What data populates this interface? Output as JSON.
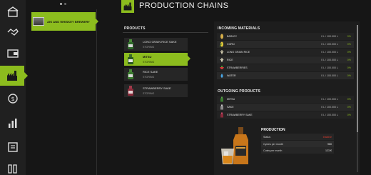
{
  "sidebar": {
    "items": [
      {
        "icon": "warehouse-icon"
      },
      {
        "icon": "handshake-icon"
      },
      {
        "icon": "wallet-icon"
      },
      {
        "icon": "calendar-icon"
      },
      {
        "icon": "production-chains-icon"
      },
      {
        "icon": "contracts-icon"
      },
      {
        "icon": "statistics-icon"
      },
      {
        "icon": "list-icon"
      },
      {
        "icon": "finances-icon"
      }
    ]
  },
  "production_point": {
    "label": "AKI AND WHISKEY BREWERY"
  },
  "header": {
    "title": "PRODUCTION CHAINS"
  },
  "products": {
    "title": "PRODUCTS",
    "items": [
      {
        "name": "LONG GRAIN RICE SAKE",
        "status": "STORING"
      },
      {
        "name": "MITSU",
        "status": "STORING"
      },
      {
        "name": "RICE SAKE",
        "status": "STORING"
      },
      {
        "name": "STRAWBERRY SAKE",
        "status": "STORING"
      }
    ]
  },
  "incoming": {
    "title": "INCOMING MATERIALS",
    "items": [
      {
        "name": "BARLEY",
        "qty": "0 L / 100.000 L",
        "pct": "0%",
        "icon": "barley-icon",
        "color": "#d8b04a"
      },
      {
        "name": "CORN",
        "qty": "0 L / 100.000 L",
        "pct": "0%",
        "icon": "corn-icon",
        "color": "#e8c83a"
      },
      {
        "name": "LONG GRAIN RICE",
        "qty": "0 L / 100.000 L",
        "pct": "0%",
        "icon": "rice-icon",
        "color": "#d9d2b4"
      },
      {
        "name": "RICE",
        "qty": "0 L / 100.000 L",
        "pct": "0%",
        "icon": "rice-icon",
        "color": "#e8e2c8"
      },
      {
        "name": "STRAWBERRIES",
        "qty": "0 L / 100.000 L",
        "pct": "0%",
        "icon": "strawberry-icon",
        "color": "#d23a3a"
      },
      {
        "name": "WATER",
        "qty": "0 L / 100.000 L",
        "pct": "0%",
        "icon": "water-icon",
        "color": "#4aa8e8"
      }
    ]
  },
  "outgoing": {
    "title": "OUTGOING PRODUCTS",
    "items": [
      {
        "name": "MITSU",
        "qty": "0 L / 100.000 L",
        "pct": "0%",
        "icon": "bottle-icon",
        "color": "#5aa04a"
      },
      {
        "name": "SAKE",
        "qty": "0 L / 100.000 L",
        "pct": "0%",
        "icon": "bottle-icon",
        "color": "#c8c8c8"
      },
      {
        "name": "STRAWBERRY SAKE",
        "qty": "0 L / 100.000 L",
        "pct": "0%",
        "icon": "bottle-icon",
        "color": "#c84a6a"
      }
    ]
  },
  "production": {
    "title": "PRODUCTION",
    "rows": [
      {
        "key": "Status",
        "value": "Inactive"
      },
      {
        "key": "Cycles per month",
        "value": "960"
      },
      {
        "key": "Costs per month",
        "value": "123 €"
      }
    ]
  },
  "colors": {
    "accent": "#8cbc1e",
    "inactive": "#e23b2e"
  }
}
